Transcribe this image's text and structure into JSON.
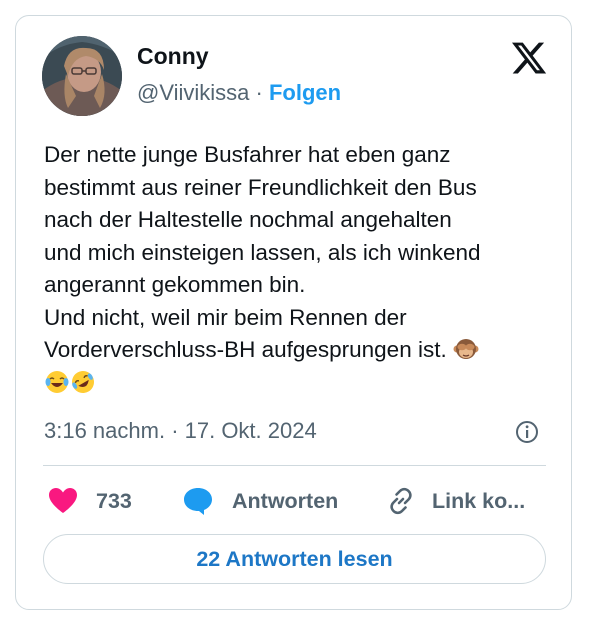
{
  "author": {
    "name": "Conny",
    "handle": "@Viivikissa",
    "separator": "·",
    "follow_label": "Folgen"
  },
  "platform_icon": "x-logo-icon",
  "tweet": {
    "text": "Der nette junge Busfahrer hat eben ganz\nbestimmt aus reiner Freundlichkeit den Bus\nnach der Haltestelle nochmal angehalten\nund mich einsteigen lassen, als ich winkend\nangerannt gekommen bin.\nUnd nicht, weil mir beim Rennen der\nVorderverschluss-BH aufgesprungen ist.",
    "emojis": [
      "see-no-evil-monkey",
      "face-with-tears-of-joy",
      "rolling-on-the-floor-laughing"
    ]
  },
  "meta": {
    "timestamp": "3:16 nachm. · 17. Okt. 2024",
    "info_icon": "info-icon"
  },
  "actions": {
    "like_count": "733",
    "reply_label": "Antworten",
    "link_label": "Link ko..."
  },
  "read_replies_label": "22 Antworten lesen",
  "colors": {
    "accent": "#1d9bf0",
    "like": "#f91880",
    "text": "#0f1419",
    "muted": "#536471",
    "border": "#cfd9de"
  }
}
